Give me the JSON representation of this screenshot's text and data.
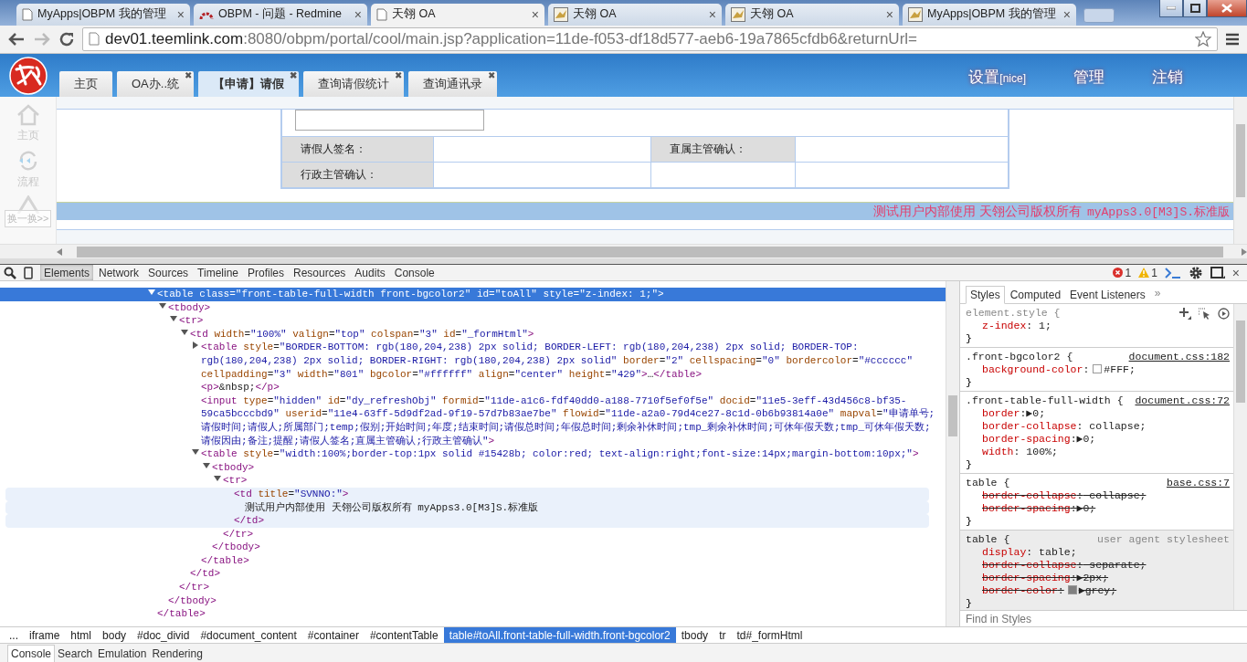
{
  "browser": {
    "tabs": [
      {
        "title": "MyApps|OBPM 我的管理",
        "kind": "page",
        "selected": false
      },
      {
        "title": "OBPM - 问题 - Redmine",
        "kind": "redmine",
        "selected": false
      },
      {
        "title": "天翎 OA",
        "kind": "page",
        "selected": true
      },
      {
        "title": "天翎 OA",
        "kind": "cat",
        "selected": false
      },
      {
        "title": "天翎 OA",
        "kind": "cat",
        "selected": false
      },
      {
        "title": "MyApps|OBPM 我的管理",
        "kind": "cat",
        "selected": false
      }
    ],
    "close_glyph": "×",
    "url": {
      "host": "dev01.teemlink.com",
      "rest": ":8080/obpm/portal/cool/main.jsp?application=11de-f053-df18d577-aeb6-19a7865cfdb6&returnUrl="
    }
  },
  "page": {
    "tabs": [
      {
        "label": "主页",
        "selected": false,
        "closable": false
      },
      {
        "label": "OA办..统",
        "selected": false,
        "closable": true
      },
      {
        "label": "【申请】请假",
        "selected": true,
        "closable": true
      },
      {
        "label": "查询请假统计",
        "selected": false,
        "closable": true
      },
      {
        "label": "查询通讯录",
        "selected": false,
        "closable": true
      }
    ],
    "tab_close": "✖",
    "links": [
      {
        "label": "设置",
        "suffix": "[nice]"
      },
      {
        "label": "管理"
      },
      {
        "label": "注销"
      }
    ],
    "sidebar": [
      {
        "label": "主页",
        "kind": "home"
      },
      {
        "label": "流程",
        "kind": "refresh"
      }
    ],
    "swap_button": "换一换>>",
    "form_rows": [
      {
        "kind": "textarea"
      },
      {
        "kind": "fields",
        "cells": [
          {
            "kind": "label",
            "label": "请假人签名："
          },
          {
            "kind": "empty"
          },
          {
            "kind": "label",
            "label": "直属主管确认："
          },
          {
            "kind": "empty"
          }
        ]
      },
      {
        "kind": "fields",
        "cells": [
          {
            "kind": "label",
            "label": "行政主管确认："
          },
          {
            "kind": "empty"
          },
          {
            "kind": "empty"
          },
          {
            "kind": "empty"
          }
        ]
      }
    ],
    "footer": {
      "text": "测试用户内部使用 天翎公司版权所有",
      "version": "myApps3.0[M3]S.标准版"
    }
  },
  "devtools": {
    "tabs": [
      {
        "label": "Elements",
        "selected": true
      },
      {
        "label": "Network",
        "selected": false
      },
      {
        "label": "Sources",
        "selected": false
      },
      {
        "label": "Timeline",
        "selected": false
      },
      {
        "label": "Profiles",
        "selected": false
      },
      {
        "label": "Resources",
        "selected": false
      },
      {
        "label": "Audits",
        "selected": false
      },
      {
        "label": "Console",
        "selected": false
      }
    ],
    "errors": "1",
    "warnings": "1",
    "close_glyph": "×",
    "dom": [
      {
        "kind": "branch",
        "expanded": true,
        "selected": true,
        "hovered": false,
        "open": "<table class=\"front-table-full-width front-bgcolor2\" id=\"toAll\" style=\"z-index: 1;\">",
        "close": "</table>",
        "children": [
          {
            "kind": "branch",
            "expanded": true,
            "selected": false,
            "hovered": false,
            "open": "<tbody>",
            "close": "</tbody>",
            "children": [
              {
                "kind": "branch",
                "expanded": true,
                "selected": false,
                "hovered": false,
                "open": "<tr>",
                "close": "</tr>",
                "children": [
                  {
                    "kind": "branch",
                    "expanded": true,
                    "selected": false,
                    "hovered": false,
                    "open": "<td width=\"100%\" valign=\"top\" colspan=\"3\" id=\"_formHtml\">",
                    "close": "</td>",
                    "children": [
                      {
                        "kind": "branch",
                        "expanded": false,
                        "selected": false,
                        "hovered": false,
                        "open": "<table style=\"BORDER-BOTTOM: rgb(180,204,238) 2px solid; BORDER-LEFT: rgb(180,204,238) 2px solid; BORDER-TOP: rgb(180,204,238) 2px solid; BORDER-RIGHT: rgb(180,204,238) 2px solid\" border=\"2\" cellspacing=\"0\" bordercolor=\"#cccccc\" cellpadding=\"3\" width=\"801\" bgcolor=\"#ffffff\" align=\"center\" height=\"429\">…</table>"
                      },
                      {
                        "kind": "leaf",
                        "selected": false,
                        "hovered": false,
                        "open": "<p>&nbsp;</p>"
                      },
                      {
                        "kind": "leaf",
                        "selected": false,
                        "hovered": false,
                        "open": "<input type=\"hidden\" id=\"dy_refreshObj\" formid=\"11de-a1c6-fdf40dd0-a188-7710f5ef0f5e\" docid=\"11e5-3eff-43d456c8-bf35-59ca5bcccbd9\" userid=\"11e4-63ff-5d9df2ad-9f19-57d7b83ae7be\" flowid=\"11de-a2a0-79d4ce27-8c1d-0b6b93814a0e\" mapval=\"申请单号;请假时间;请假人;所属部门;temp;假别;开始时间;年度;结束时间;请假总时间;年假总时间;剩余补休时间;tmp_剩余补休时间;可休年假天数;tmp_可休年假天数;请假因由;备注;提醒;请假人签名;直属主管确认;行政主管确认\">"
                      },
                      {
                        "kind": "branch",
                        "expanded": true,
                        "selected": false,
                        "hovered": false,
                        "open": "<table style=\"width:100%;border-top:1px solid #15428b; color:red; text-align:right;font-size:14px;margin-bottom:10px;\">",
                        "close": "</table>",
                        "children": [
                          {
                            "kind": "branch",
                            "expanded": true,
                            "selected": false,
                            "hovered": false,
                            "open": "<tbody>",
                            "close": "</tbody>",
                            "children": [
                              {
                                "kind": "branch",
                                "expanded": true,
                                "selected": false,
                                "hovered": false,
                                "open": "<tr>",
                                "close": "</tr>",
                                "children": [
                                  {
                                    "kind": "block",
                                    "selected": false,
                                    "hovered": true,
                                    "open": "<td title=\"SVNNO:\">",
                                    "close": "</td>",
                                    "children": [
                                      {
                                        "kind": "text",
                                        "selected": false,
                                        "hovered": true,
                                        "open": "测试用户内部使用 天翎公司版权所有 myApps3.0[M3]S.标准版"
                                      }
                                    ]
                                  }
                                ]
                              }
                            ]
                          }
                        ]
                      }
                    ]
                  }
                ]
              }
            ]
          }
        ]
      }
    ],
    "side_tabs": [
      {
        "label": "Styles",
        "selected": true
      },
      {
        "label": "Computed",
        "selected": false
      },
      {
        "label": "Event Listeners",
        "selected": false
      }
    ],
    "side_more": "»",
    "rules": [
      {
        "kind": "inline",
        "selector": "element.style {",
        "props": [
          {
            "name": "z-index",
            "sep": ":",
            "value": " 1;",
            "struck": false
          }
        ],
        "close": "}"
      },
      {
        "kind": "author",
        "selector": ".front-bgcolor2 {",
        "source": "document.css:182",
        "props": [
          {
            "name": "background-color",
            "sep": ":",
            "value": "#FFF;",
            "struck": false,
            "color": "#ffffff"
          }
        ],
        "close": "}"
      },
      {
        "kind": "author",
        "selector": ".front-table-full-width {",
        "source": "document.css:72",
        "props": [
          {
            "name": "border",
            "sep": ":",
            "value": "▶0;",
            "struck": false
          },
          {
            "name": "border-collapse",
            "sep": ":",
            "value": " collapse;",
            "struck": false
          },
          {
            "name": "border-spacing",
            "sep": ":",
            "value": "▶0;",
            "struck": false
          },
          {
            "name": "width",
            "sep": ":",
            "value": " 100%;",
            "struck": false
          }
        ],
        "close": "}"
      },
      {
        "kind": "author",
        "selector": "table {",
        "source": "base.css:7",
        "props": [
          {
            "name": "border-collapse",
            "sep": ":",
            "value": " collapse;",
            "struck": true
          },
          {
            "name": "border-spacing",
            "sep": ":",
            "value": "▶0;",
            "struck": true
          }
        ],
        "close": "}"
      },
      {
        "kind": "agent",
        "selector": "table {",
        "source": "user agent stylesheet",
        "props": [
          {
            "name": "display",
            "sep": ":",
            "value": " table;",
            "struck": false
          },
          {
            "name": "border-collapse",
            "sep": ":",
            "value": " separate;",
            "struck": true
          },
          {
            "name": "border-spacing",
            "sep": ":",
            "value": "▶2px;",
            "struck": true
          },
          {
            "name": "border-color",
            "sep": ":",
            "value": "▶grey;",
            "struck": true,
            "color": "#808080"
          }
        ],
        "close": "}"
      }
    ],
    "find_placeholder": "Find in Styles",
    "breadcrumbs": [
      {
        "label": "...",
        "selected": false
      },
      {
        "label": "iframe",
        "selected": false
      },
      {
        "label": "html",
        "selected": false
      },
      {
        "label": "body",
        "selected": false
      },
      {
        "label": "#doc_divid",
        "selected": false
      },
      {
        "label": "#document_content",
        "selected": false
      },
      {
        "label": "#container",
        "selected": false
      },
      {
        "label": "#contentTable",
        "selected": false
      },
      {
        "label": "table#toAll.front-table-full-width.front-bgcolor2",
        "selected": true
      },
      {
        "label": "tbody",
        "selected": false
      },
      {
        "label": "tr",
        "selected": false
      },
      {
        "label": "td#_formHtml",
        "selected": false
      }
    ],
    "drawer_tabs": [
      {
        "label": "Console",
        "selected": true
      },
      {
        "label": "Search",
        "selected": false
      },
      {
        "label": "Emulation",
        "selected": false
      },
      {
        "label": "Rendering",
        "selected": false
      }
    ]
  }
}
